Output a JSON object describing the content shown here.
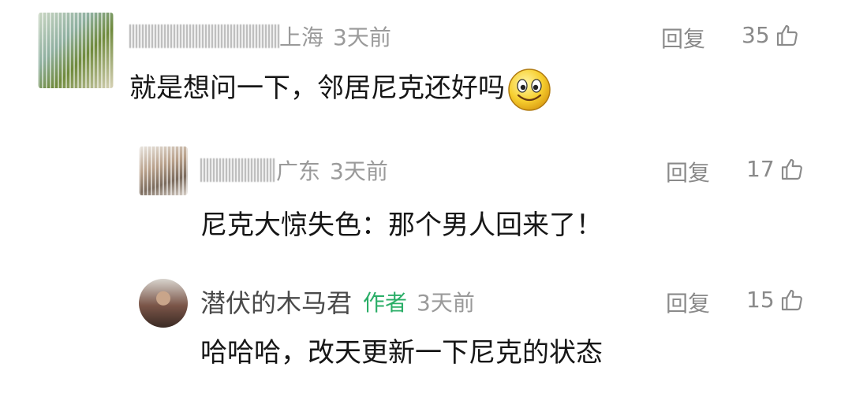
{
  "comments": [
    {
      "location": "上海",
      "time": "3天前",
      "reply_label": "回复",
      "likes": "35",
      "text": "就是想问一下，邻居尼克还好吗",
      "emoji": "smile-emoji"
    },
    {
      "location": "广东",
      "time": "3天前",
      "reply_label": "回复",
      "likes": "17",
      "text": "尼克大惊失色：那个男人回来了！"
    },
    {
      "username": "潜伏的木马君",
      "author_tag": "作者",
      "time": "3天前",
      "reply_label": "回复",
      "likes": "15",
      "text": "哈哈哈，改天更新一下尼克的状态"
    }
  ],
  "colors": {
    "meta": "#9a9a9a",
    "author_tag": "#2aae67",
    "text": "#161616"
  },
  "icons": [
    "thumbs-up-icon",
    "smile-emoji"
  ]
}
